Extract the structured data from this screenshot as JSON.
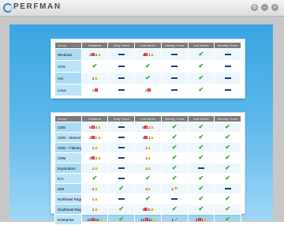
{
  "app": {
    "name": "PERFMAN"
  },
  "window_controls": [
    {
      "name": "settings-button",
      "glyph": "⚙"
    },
    {
      "name": "minimize-button",
      "glyph": "–"
    },
    {
      "name": "close-button",
      "glyph": "×"
    }
  ],
  "columns": [
    "Group",
    "Realtime",
    "Daily Trend",
    "Last Week",
    "Weekly Trend",
    "Last Month",
    "Monthly Trend"
  ],
  "tables": [
    {
      "name": "table-top",
      "rows": [
        {
          "group": "Windows",
          "cells": [
            {
              "items": [
                {
                  "t": "n",
                  "v": "3"
                },
                {
                  "t": "err",
                  "v": "3"
                },
                {
                  "t": "n",
                  "v": "3"
                },
                {
                  "t": "warn"
                }
              ]
            },
            {
              "t": "dash"
            },
            {
              "items": [
                {
                  "t": "n",
                  "v": "3"
                },
                {
                  "t": "err",
                  "v": "3"
                },
                {
                  "t": "n",
                  "v": "4"
                },
                {
                  "t": "warn"
                }
              ]
            },
            {
              "t": "dash"
            },
            {
              "t": "check"
            },
            {
              "t": "dash"
            }
          ]
        },
        {
          "group": "z/OS",
          "cells": [
            {
              "t": "check"
            },
            {
              "t": "dash"
            },
            {
              "t": "check"
            },
            {
              "t": "dash"
            },
            {
              "t": "check"
            },
            {
              "t": "dash"
            }
          ]
        },
        {
          "group": "AIX",
          "cells": [
            {
              "items": [
                {
                  "t": "n",
                  "v": "3"
                },
                {
                  "t": "warn"
                }
              ]
            },
            {
              "t": "dash"
            },
            {
              "t": "check"
            },
            {
              "t": "dash"
            },
            {
              "t": "check"
            },
            {
              "t": "dash"
            }
          ]
        },
        {
          "group": "Linux",
          "cells": [
            {
              "items": [
                {
                  "t": "n",
                  "v": "1"
                },
                {
                  "t": "err",
                  "v": "1"
                }
              ]
            },
            {
              "t": "dash"
            },
            {
              "items": [
                {
                  "t": "n",
                  "v": "2"
                },
                {
                  "t": "err",
                  "v": "2"
                }
              ]
            },
            {
              "t": "dash"
            },
            {
              "t": "check"
            },
            {
              "t": "dash"
            }
          ]
        }
      ]
    },
    {
      "name": "table-bottom",
      "rows": [
        {
          "group": "CMS",
          "cells": [
            {
              "items": [
                {
                  "t": "n",
                  "v": "5"
                },
                {
                  "t": "err",
                  "v": "3"
                },
                {
                  "t": "n",
                  "v": "4"
                },
                {
                  "t": "warn"
                }
              ]
            },
            {
              "t": "dash"
            },
            {
              "items": [
                {
                  "t": "n",
                  "v": "5"
                },
                {
                  "t": "err",
                  "v": "3"
                },
                {
                  "t": "n",
                  "v": "2"
                },
                {
                  "t": "warn"
                }
              ]
            },
            {
              "t": "check"
            },
            {
              "t": "check"
            },
            {
              "t": "check"
            }
          ]
        },
        {
          "group": "CMS – Denver",
          "cells": [
            {
              "items": [
                {
                  "t": "n",
                  "v": "3"
                },
                {
                  "t": "err",
                  "v": "2"
                },
                {
                  "t": "n",
                  "v": "1"
                },
                {
                  "t": "warn"
                }
              ]
            },
            {
              "t": "dash"
            },
            {
              "items": [
                {
                  "t": "n",
                  "v": "3"
                },
                {
                  "t": "err",
                  "v": "3"
                },
                {
                  "t": "n",
                  "v": "1"
                },
                {
                  "t": "warn"
                }
              ]
            },
            {
              "t": "check"
            },
            {
              "t": "check"
            },
            {
              "t": "check"
            }
          ]
        },
        {
          "group": "CMS – Flamington",
          "cells": [
            {
              "items": [
                {
                  "t": "n",
                  "v": "1"
                },
                {
                  "t": "warn"
                }
              ]
            },
            {
              "t": "dash"
            },
            {
              "items": [
                {
                  "t": "n",
                  "v": "1"
                },
                {
                  "t": "warn"
                }
              ]
            },
            {
              "t": "check"
            },
            {
              "t": "check"
            },
            {
              "t": "check"
            }
          ]
        },
        {
          "group": "CRM",
          "cells": [
            {
              "items": [
                {
                  "t": "n",
                  "v": "3"
                },
                {
                  "t": "err",
                  "v": "3"
                },
                {
                  "t": "n",
                  "v": "3"
                },
                {
                  "t": "warn"
                }
              ]
            },
            {
              "t": "dash"
            },
            {
              "items": [
                {
                  "t": "n",
                  "v": "1"
                },
                {
                  "t": "warn"
                }
              ]
            },
            {
              "t": "check"
            },
            {
              "t": "check"
            },
            {
              "t": "check"
            }
          ]
        },
        {
          "group": "Exploration",
          "cells": [
            {
              "items": [
                {
                  "t": "n",
                  "v": "1"
                },
                {
                  "t": "warn"
                }
              ]
            },
            {
              "t": "dash"
            },
            {
              "items": [
                {
                  "t": "n",
                  "v": "1"
                },
                {
                  "t": "warn"
                }
              ]
            },
            {
              "t": "check"
            },
            {
              "t": "dash"
            },
            {
              "t": "check"
            }
          ]
        },
        {
          "group": "ICA",
          "cells": [
            {
              "t": "check"
            },
            {
              "t": "dash"
            },
            {
              "t": "check"
            },
            {
              "t": "check"
            },
            {
              "t": "check"
            },
            {
              "t": "check"
            }
          ]
        },
        {
          "group": "ISM",
          "cells": [
            {
              "items": [
                {
                  "t": "n",
                  "v": "2"
                },
                {
                  "t": "warn"
                }
              ]
            },
            {
              "t": "check"
            },
            {
              "items": [
                {
                  "t": "n",
                  "v": "3"
                },
                {
                  "t": "warn"
                }
              ]
            },
            {
              "items": [
                {
                  "t": "n",
                  "v": "1"
                },
                {
                  "t": "trend-flag"
                }
              ]
            },
            {
              "t": "check"
            },
            {
              "t": "dash"
            }
          ]
        },
        {
          "group": "Northeast Region",
          "cells": [
            {
              "items": [
                {
                  "t": "n",
                  "v": "1"
                },
                {
                  "t": "warn"
                }
              ]
            },
            {
              "t": "dash"
            },
            {
              "t": "check"
            },
            {
              "t": "dash"
            },
            {
              "t": "check"
            },
            {
              "t": "check"
            }
          ]
        },
        {
          "group": "Southeast Region",
          "cells": [
            {
              "items": [
                {
                  "t": "n",
                  "v": "1"
                },
                {
                  "t": "warn"
                }
              ]
            },
            {
              "t": "check"
            },
            {
              "items": [
                {
                  "t": "n",
                  "v": "5"
                },
                {
                  "t": "err",
                  "v": "3"
                },
                {
                  "t": "n",
                  "v": "5"
                },
                {
                  "t": "warn"
                }
              ]
            },
            {
              "t": "check"
            },
            {
              "t": "check"
            },
            {
              "t": "check"
            }
          ]
        },
        {
          "group": "Enterprise",
          "cells": [
            {
              "items": [
                {
                  "t": "n",
                  "v": "22"
                },
                {
                  "t": "err",
                  "v": "2"
                },
                {
                  "t": "n",
                  "v": "18"
                },
                {
                  "t": "warn"
                }
              ]
            },
            {
              "t": "check"
            },
            {
              "items": [
                {
                  "t": "n",
                  "v": "13"
                },
                {
                  "t": "err",
                  "v": "2"
                },
                {
                  "t": "n",
                  "v": "11"
                },
                {
                  "t": "warn"
                }
              ]
            },
            {
              "items": [
                {
                  "t": "n",
                  "v": "1"
                },
                {
                  "t": "trend-up"
                }
              ]
            },
            {
              "items": [
                {
                  "t": "n",
                  "v": "3"
                },
                {
                  "t": "err",
                  "v": "1"
                },
                {
                  "t": "n",
                  "v": "1"
                },
                {
                  "t": "warn"
                }
              ]
            },
            {
              "t": "check"
            }
          ]
        }
      ]
    }
  ]
}
